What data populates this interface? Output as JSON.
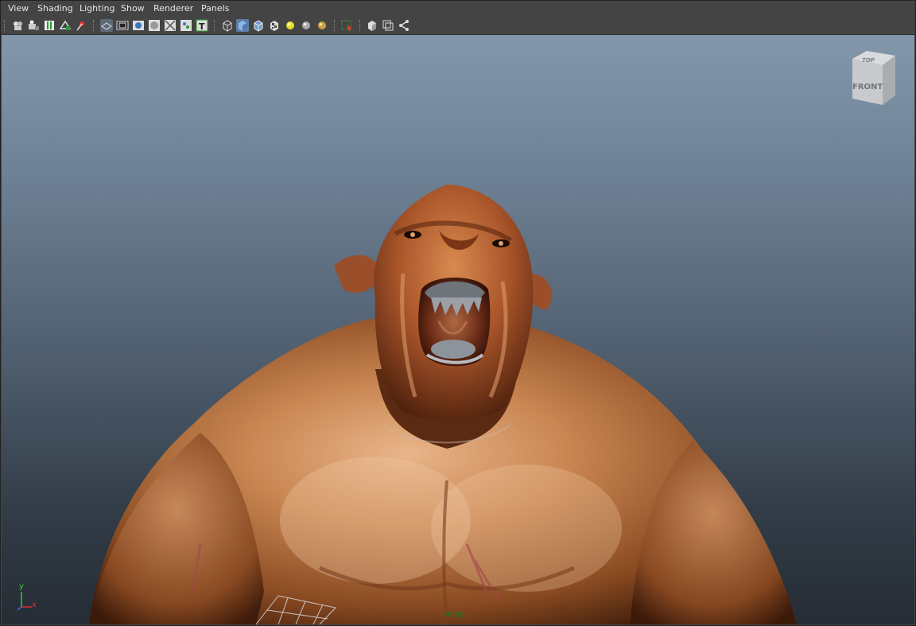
{
  "menubar": {
    "items": [
      "View",
      "Shading",
      "Lighting",
      "Show",
      "Renderer",
      "Panels"
    ]
  },
  "toolbar": {
    "icons": [
      "select-camera-icon",
      "camera-attributes-icon",
      "bookmarks-icon",
      "image-plane-icon",
      "two-d-pan-zoom-icon",
      "grid-icon",
      "film-gate-icon",
      "resolution-gate-icon",
      "gate-mask-icon",
      "field-chart-icon",
      "safe-action-icon",
      "safe-title-icon",
      "wireframe-icon",
      "smooth-shade-icon",
      "wireframe-on-shaded-icon",
      "textured-icon",
      "default-lighting-icon",
      "all-lights-icon",
      "shadows-icon",
      "isolate-select-icon",
      "xray-icon",
      "xray-active-components-icon",
      "xray-joints-icon"
    ]
  },
  "viewport": {
    "camera_label": "persp",
    "viewcube": {
      "top_label": "TOP",
      "front_label": "FRONT"
    },
    "axis": {
      "y_label": "y",
      "x_label": "x"
    }
  },
  "colors": {
    "ui_bg": "#444444",
    "menu_text": "#e6e6e6",
    "viewport_top": "#8397ab",
    "viewport_bottom": "#252c34",
    "skin": "#b5642f",
    "axis_y": "#33cc33",
    "axis_x": "#e03030"
  }
}
